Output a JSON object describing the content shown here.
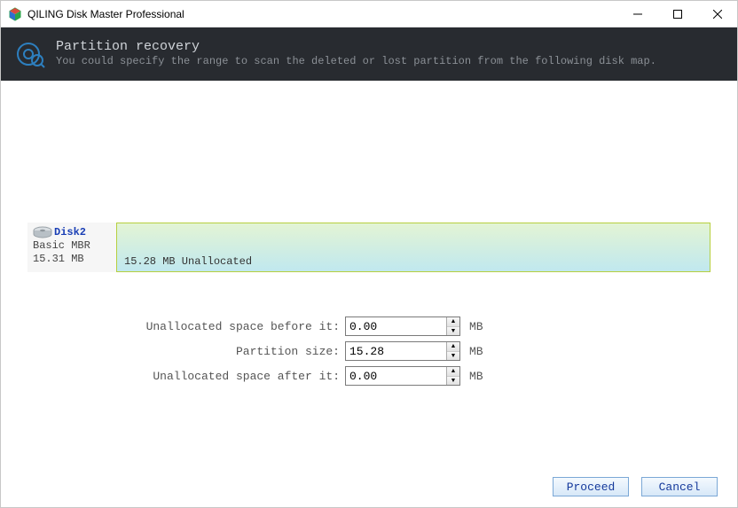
{
  "window": {
    "title": "QILING Disk Master Professional"
  },
  "header": {
    "title": "Partition recovery",
    "subtitle": "You could specify the range to scan the deleted or lost partition from the following disk map."
  },
  "disk": {
    "name": "Disk2",
    "type": "Basic MBR",
    "size": "15.31 MB",
    "segment_label": "15.28 MB Unallocated"
  },
  "form": {
    "before_label": "Unallocated space before it:",
    "before_value": "0.00",
    "size_label": "Partition size:",
    "size_value": "15.28",
    "after_label": "Unallocated space after it:",
    "after_value": "0.00",
    "unit": "MB"
  },
  "footer": {
    "proceed": "Proceed",
    "cancel": "Cancel"
  },
  "icons": {
    "app": "cube-icon",
    "recovery": "disk-search-icon",
    "disk": "hdd-icon"
  }
}
